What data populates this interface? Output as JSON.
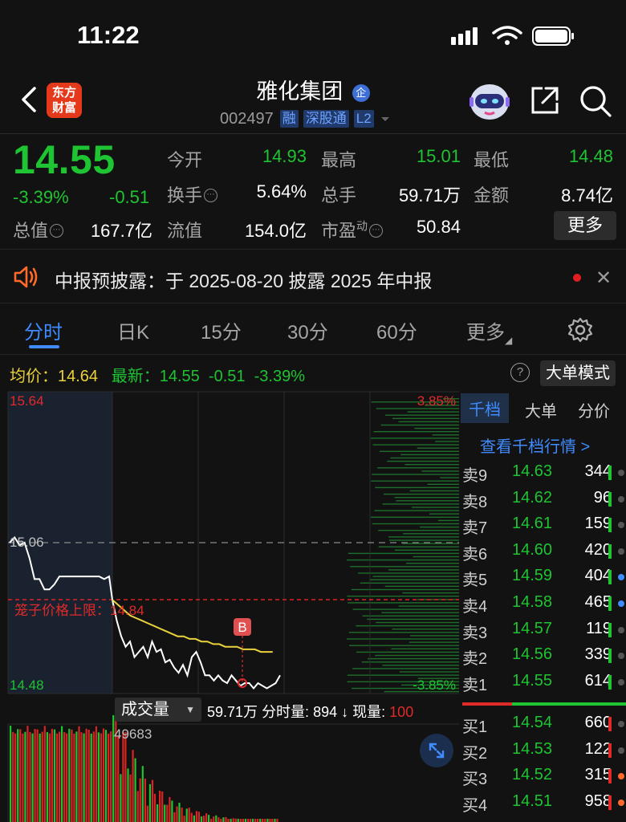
{
  "status_bar": {
    "time": "11:22"
  },
  "header": {
    "logo_line1": "东方",
    "logo_line2": "财富",
    "name": "雅化集团",
    "name_badge": "企",
    "code": "002497",
    "tags": [
      "融",
      "深股通",
      "L2"
    ]
  },
  "quote": {
    "price": "14.55",
    "change_pct": "-3.39%",
    "change_val": "-0.51",
    "fields": {
      "open_label": "今开",
      "open": "14.93",
      "high_label": "最高",
      "high": "15.01",
      "low_label": "最低",
      "low": "14.48",
      "turnover_label": "换手",
      "turnover": "5.64%",
      "volume_label": "总手",
      "volume": "59.71万",
      "amount_label": "金额",
      "amount": "8.74亿",
      "mktcap_label": "总值",
      "mktcap": "167.7亿",
      "float_label": "流值",
      "float": "154.0亿",
      "pe_label": "市盈",
      "pe_sup": "动",
      "pe": "50.84"
    },
    "more_label": "更多"
  },
  "notice": {
    "text": "中报预披露：于 2025-08-20 披露 2025 年中报"
  },
  "tabs": [
    "分时",
    "日K",
    "15分",
    "30分",
    "60分",
    "更多"
  ],
  "avg_row": {
    "avg_label": "均价：",
    "avg": "14.64",
    "latest_label": "最新：",
    "latest": "14.55",
    "latest_chg": "-0.51",
    "latest_pct": "-3.39%"
  },
  "big_mode_label": "大单模式",
  "chart_labels": {
    "y_top": "15.64",
    "y_mid": "15.06",
    "y_bottom": "14.48",
    "pct_top": "3.85%",
    "pct_bottom": "-3.85%",
    "cage_label": "笼子价格上限：14.84",
    "b_marker": "B",
    "vol_peak": "49683"
  },
  "chart_data": {
    "type": "line",
    "y_range": [
      14.48,
      15.64
    ],
    "prev_close": 15.06,
    "cage_upper": 14.84,
    "series": [
      {
        "name": "",
        "values": [
          15.06,
          15.08,
          15.05,
          15.06,
          15.0,
          14.92,
          14.92,
          14.88,
          14.88,
          14.9,
          14.93,
          14.93,
          14.93,
          14.93,
          14.93,
          14.93,
          14.93,
          14.93,
          14.93,
          14.92,
          14.93,
          14.84,
          14.76,
          14.7,
          14.66,
          14.68,
          14.62,
          14.64,
          14.66,
          14.62,
          14.68,
          14.64,
          14.65,
          14.6,
          14.61,
          14.58,
          14.56,
          14.59,
          14.55,
          14.62,
          14.64,
          14.6,
          14.55,
          14.55,
          14.53,
          14.55,
          14.53,
          14.52,
          14.55,
          14.53,
          14.51,
          14.52,
          14.52,
          14.5,
          14.52,
          14.51,
          14.5,
          14.51,
          14.52,
          14.55
        ]
      },
      {
        "name": "",
        "values": [
          14.84,
          14.82,
          14.8,
          14.78,
          14.77,
          14.76,
          14.75,
          14.74,
          14.73,
          14.72,
          14.71,
          14.7,
          14.7,
          14.69,
          14.69,
          14.68,
          14.68,
          14.67,
          14.67,
          14.66,
          14.66,
          14.66,
          14.65,
          14.65,
          14.65,
          14.64,
          14.64,
          14.64
        ]
      }
    ]
  },
  "order_book": {
    "tabs": [
      "千档",
      "大单",
      "分价"
    ],
    "link": "查看千档行情 >",
    "asks": [
      {
        "label": "卖9",
        "price": "14.63",
        "vol": "344",
        "dot": "gray"
      },
      {
        "label": "卖8",
        "price": "14.62",
        "vol": "96",
        "dot": "gray"
      },
      {
        "label": "卖7",
        "price": "14.61",
        "vol": "159",
        "dot": "gray"
      },
      {
        "label": "卖6",
        "price": "14.60",
        "vol": "420",
        "dot": "gray"
      },
      {
        "label": "卖5",
        "price": "14.59",
        "vol": "404",
        "dot": "blue"
      },
      {
        "label": "卖4",
        "price": "14.58",
        "vol": "465",
        "dot": "blue"
      },
      {
        "label": "卖3",
        "price": "14.57",
        "vol": "119",
        "dot": "gray"
      },
      {
        "label": "卖2",
        "price": "14.56",
        "vol": "339",
        "dot": "gray"
      },
      {
        "label": "卖1",
        "price": "14.55",
        "vol": "614",
        "dot": "gray"
      }
    ],
    "bids": [
      {
        "label": "买1",
        "price": "14.54",
        "vol": "660",
        "dot": "gray"
      },
      {
        "label": "买2",
        "price": "14.53",
        "vol": "122",
        "dot": "gray"
      },
      {
        "label": "买3",
        "price": "14.52",
        "vol": "315",
        "dot": "orange"
      },
      {
        "label": "买4",
        "price": "14.51",
        "vol": "958",
        "dot": "orange"
      }
    ]
  },
  "volume": {
    "select_label": "成交量",
    "info_total": "59.71万",
    "info_label": "分时量: 894",
    "info_now_label": "现量:",
    "info_now": "100"
  }
}
